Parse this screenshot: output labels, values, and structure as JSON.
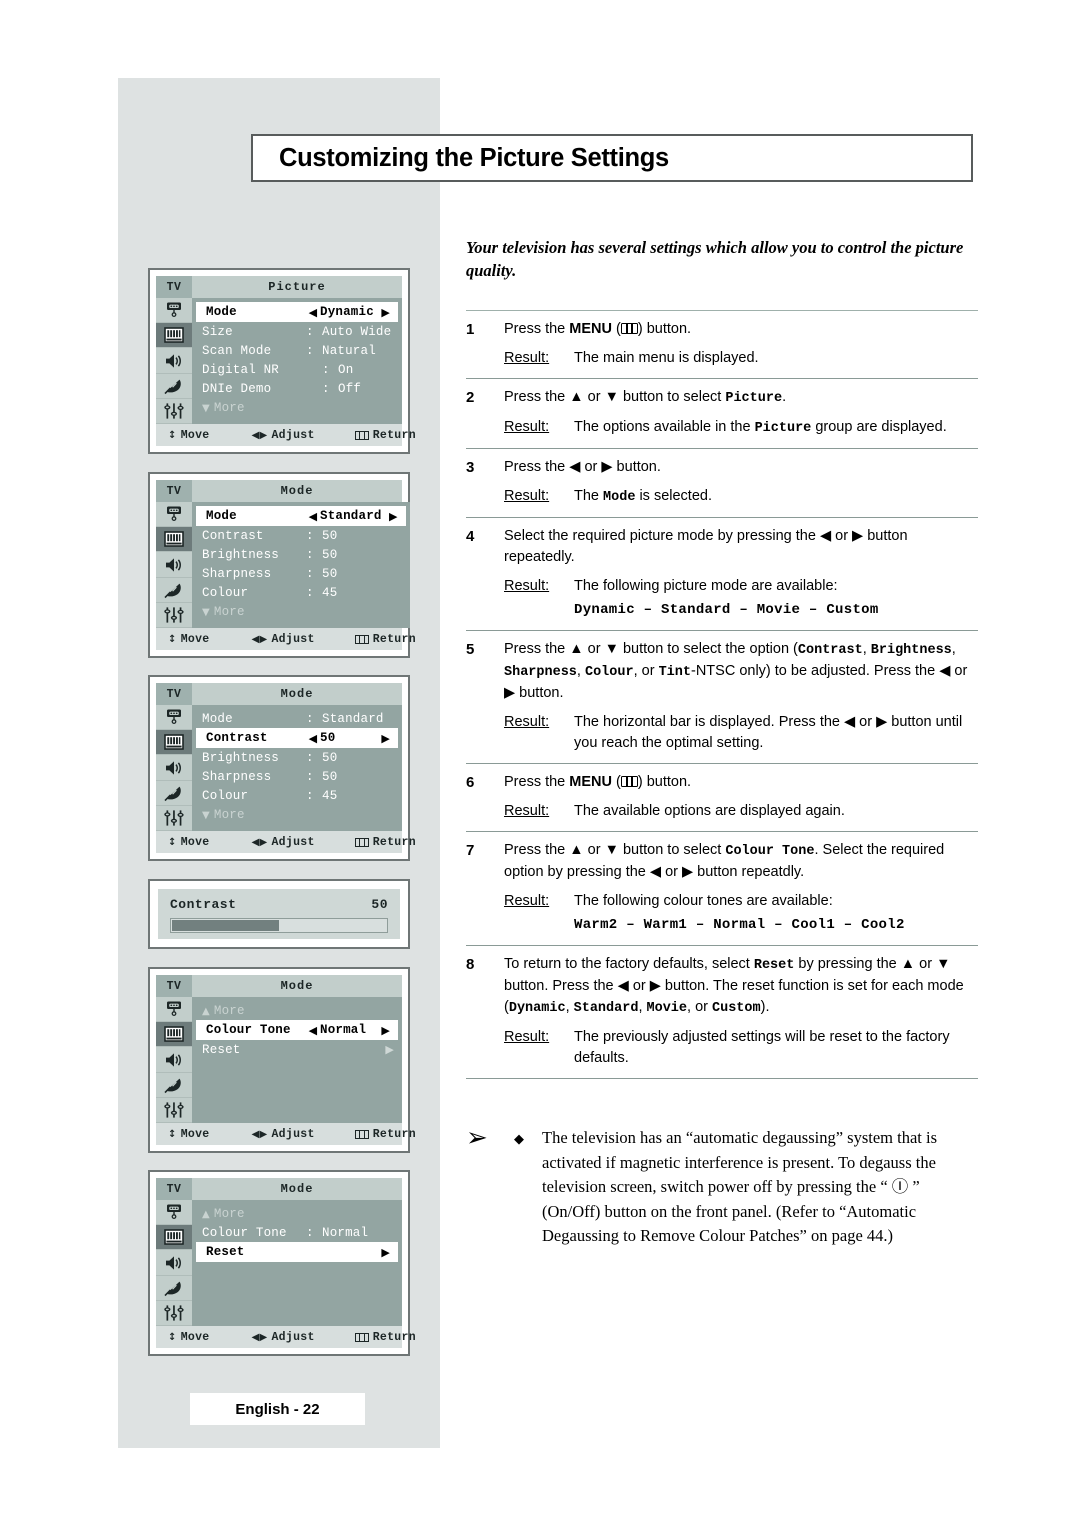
{
  "page": {
    "title": "Customizing the Picture Settings",
    "intro": "Your television has several settings which allow you to control the picture quality.",
    "footer_label": "English - 22"
  },
  "steps": [
    {
      "num": "1",
      "text_pre": "Press the ",
      "text_bold": "MENU",
      "text_post": " button.",
      "has_menu_glyph": true,
      "result_label": "Result:",
      "result": "The main menu is displayed."
    },
    {
      "num": "2",
      "text_pre": "Press the ▲ or ▼ button to select ",
      "text_mono": "Picture",
      "text_post": ".",
      "result_label": "Result:",
      "result_pre": "The options available in the ",
      "result_mono": "Picture",
      "result_post": " group are displayed."
    },
    {
      "num": "3",
      "text": "Press the ◀ or ▶ button.",
      "result_label": "Result:",
      "result_pre": "The ",
      "result_mono": "Mode",
      "result_post": " is selected."
    },
    {
      "num": "4",
      "text": "Select the required picture mode by pressing the ◀ or ▶ button repeatedly.",
      "result_label": "Result:",
      "result": "The following picture mode are available:",
      "list_line": "Dynamic – Standard – Movie – Custom"
    },
    {
      "num": "5",
      "text_pre": "Press the ▲ or ▼ button to select the option (",
      "opt1": "Contrast",
      "sep1": ", ",
      "opt2": "Brightness",
      "sep2": ", ",
      "opt3": "Sharpness",
      "sep3": ", ",
      "opt4": "Colour",
      "sep4": ", or ",
      "opt5": "Tint",
      "text_post": "-NTSC only) to be adjusted. Press the ◀ or ▶ button.",
      "result_label": "Result:",
      "result": "The horizontal bar is displayed. Press the ◀ or ▶ button until you reach the optimal setting."
    },
    {
      "num": "6",
      "text_pre": "Press the ",
      "text_bold": "MENU",
      "text_post": " button.",
      "has_menu_glyph": true,
      "result_label": "Result:",
      "result": "The available options are displayed again."
    },
    {
      "num": "7",
      "text_pre": "Press the ▲ or ▼ button to select ",
      "text_mono": "Colour Tone",
      "text_post": ". Select the required option by pressing the ◀ or ▶ button repeatdly.",
      "result_label": "Result:",
      "result": "The following colour tones are available:",
      "list_line": "Warm2 – Warm1 – Normal – Cool1 – Cool2"
    },
    {
      "num": "8",
      "text_pre": "To return to the factory defaults, select ",
      "text_mono": "Reset",
      "text_mid": " by pressing the ▲ or ▼ button. Press the ◀ or ▶ button. The reset function is set for each mode (",
      "m1": "Dynamic",
      "m2": "Standard",
      "m3": "Movie",
      "m4": "Custom",
      "text_post": ").",
      "result_label": "Result:",
      "result": "The previously adjusted settings will be reset to the factory defaults."
    }
  ],
  "note": {
    "arrow": "➢",
    "bullet": "◆",
    "text": "The television has an “automatic degaussing” system that is activated if magnetic interference is present. To degauss the television screen, switch power off by pressing the “ Ⓘ ” (On/Off) button on the front panel. (Refer to “Automatic Degaussing to Remove Colour Patches” on page 44.)"
  },
  "osd_footer": {
    "move": "Move",
    "adjust": "Adjust",
    "return": "Return"
  },
  "osd_panels": [
    {
      "tv": "TV",
      "title": "Picture",
      "active_icon": 1,
      "rows": [
        {
          "type": "selected",
          "label": "Mode",
          "value": "Dynamic"
        },
        {
          "type": "normal",
          "label": "Size",
          "sep": ":",
          "value": "Auto Wide"
        },
        {
          "type": "normal",
          "label": "Scan Mode",
          "sep": ":",
          "value": "Natural"
        },
        {
          "type": "normal-wide",
          "label": "Digital NR",
          "sep": ":",
          "value": "On"
        },
        {
          "type": "normal-wide",
          "label": "DNIe Demo",
          "sep": ":",
          "value": "Off"
        },
        {
          "type": "more",
          "label": "More",
          "dir": "down"
        }
      ]
    },
    {
      "tv": "TV",
      "title": "Mode",
      "active_icon": 1,
      "rows": [
        {
          "type": "selected",
          "label": "Mode",
          "value": "Standard"
        },
        {
          "type": "normal",
          "label": "Contrast",
          "sep": ":",
          "value": "50"
        },
        {
          "type": "normal",
          "label": "Brightness",
          "sep": ":",
          "value": "50"
        },
        {
          "type": "normal",
          "label": "Sharpness",
          "sep": ":",
          "value": "50"
        },
        {
          "type": "normal",
          "label": "Colour",
          "sep": ":",
          "value": "45"
        },
        {
          "type": "more",
          "label": "More",
          "dir": "down"
        }
      ]
    },
    {
      "tv": "TV",
      "title": "Mode",
      "active_icon": 1,
      "rows": [
        {
          "type": "normal",
          "label": "Mode",
          "sep": ":",
          "value": "Standard"
        },
        {
          "type": "selected",
          "label": "Contrast",
          "value": "50"
        },
        {
          "type": "normal",
          "label": "Brightness",
          "sep": ":",
          "value": "50"
        },
        {
          "type": "normal",
          "label": "Sharpness",
          "sep": ":",
          "value": "50"
        },
        {
          "type": "normal",
          "label": "Colour",
          "sep": ":",
          "value": "45"
        },
        {
          "type": "more",
          "label": "More",
          "dir": "down"
        }
      ]
    },
    {
      "tv": "TV",
      "title": "Mode",
      "active_icon": 1,
      "rows": [
        {
          "type": "more",
          "label": "More",
          "dir": "up"
        },
        {
          "type": "selected",
          "label": "Colour Tone",
          "value": "Normal"
        },
        {
          "type": "arrow-only",
          "label": "Reset"
        },
        {
          "type": "blank"
        },
        {
          "type": "blank"
        },
        {
          "type": "blank"
        }
      ]
    },
    {
      "tv": "TV",
      "title": "Mode",
      "active_icon": 1,
      "rows": [
        {
          "type": "more",
          "label": "More",
          "dir": "up"
        },
        {
          "type": "normal",
          "label": "Colour Tone",
          "sep": ":",
          "value": "Normal"
        },
        {
          "type": "selected-arrow",
          "label": "Reset"
        },
        {
          "type": "blank"
        },
        {
          "type": "blank"
        },
        {
          "type": "blank"
        }
      ]
    }
  ],
  "bar_popup": {
    "label": "Contrast",
    "value": "50",
    "percent": 50
  },
  "colors": {
    "panel_bg": "#dee2e2",
    "osd_body": "#93a5a2",
    "osd_title": "#c2cecb",
    "osd_tv": "#9fb1ae",
    "osd_footer": "#d7dedd",
    "bar_fill": "#72807f",
    "rule": "#8a9a96"
  }
}
